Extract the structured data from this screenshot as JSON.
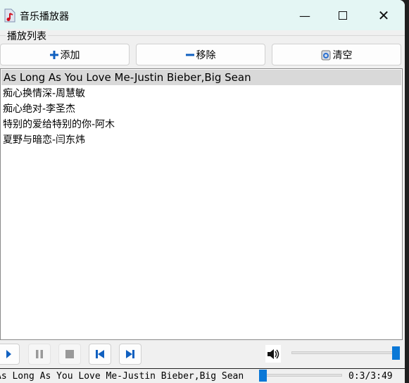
{
  "window": {
    "title": "音乐播放器",
    "icon": "music-file-icon"
  },
  "playlist": {
    "group_label": "播放列表",
    "buttons": [
      {
        "label": "添加",
        "icon": "plus-icon"
      },
      {
        "label": "移除",
        "icon": "minus-icon"
      },
      {
        "label": "清空",
        "icon": "recycle-bin-icon"
      }
    ],
    "items": [
      "As Long As You Love Me-Justin Bieber,Big Sean",
      "痴心换情深-周慧敏",
      "痴心绝对-李圣杰",
      "特别的爱给特别的你-阿木",
      "夏野与暗恋-闫东炜"
    ],
    "selected_index": 0
  },
  "controls": {
    "buttons": [
      "play",
      "pause",
      "stop",
      "previous",
      "next"
    ],
    "volume_percent": 100
  },
  "status": {
    "now_playing": "As Long As You Love Me-Justin Bieber,Big Sean",
    "time": "0:3/3:49",
    "progress_percent": 1
  },
  "colors": {
    "accent": "#0a78d7",
    "titlebar": "#e4f6f4"
  }
}
